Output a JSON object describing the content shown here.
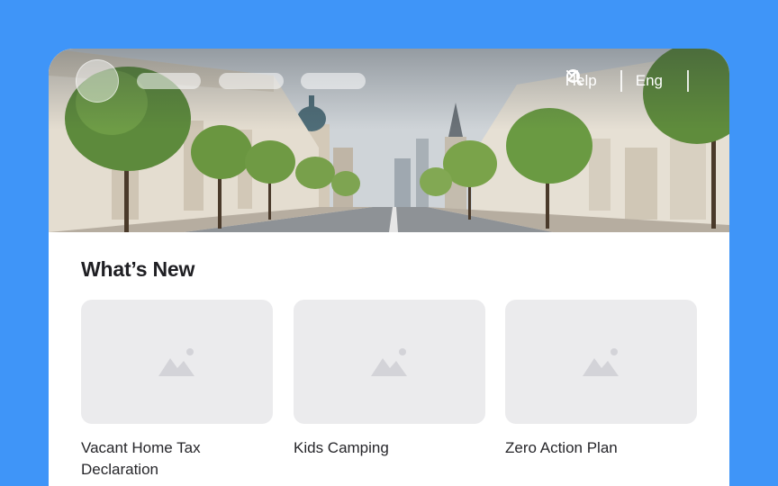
{
  "colors": {
    "page_background": "#3f95f8",
    "card_background": "#ffffff",
    "thumbnail_background": "#ebebed",
    "thumbnail_icon": "#d3d3d8"
  },
  "header": {
    "background": "city street with trees and buildings",
    "logo_icon": "logo-placeholder-circle",
    "nav_placeholders": [
      "nav-pill",
      "nav-pill",
      "nav-pill"
    ],
    "help_label": "Help",
    "help_icon": "arrow-up-right-icon",
    "language_label": "Eng",
    "language_icon": "chevron-down-icon",
    "search_icon": "search-icon"
  },
  "whats_new": {
    "title": "What’s New",
    "items": [
      {
        "label": "Vacant Home Tax Declaration",
        "image_icon": "image-placeholder-icon"
      },
      {
        "label": "Kids Camping",
        "image_icon": "image-placeholder-icon"
      },
      {
        "label": "Zero Action Plan",
        "image_icon": "image-placeholder-icon"
      }
    ]
  }
}
